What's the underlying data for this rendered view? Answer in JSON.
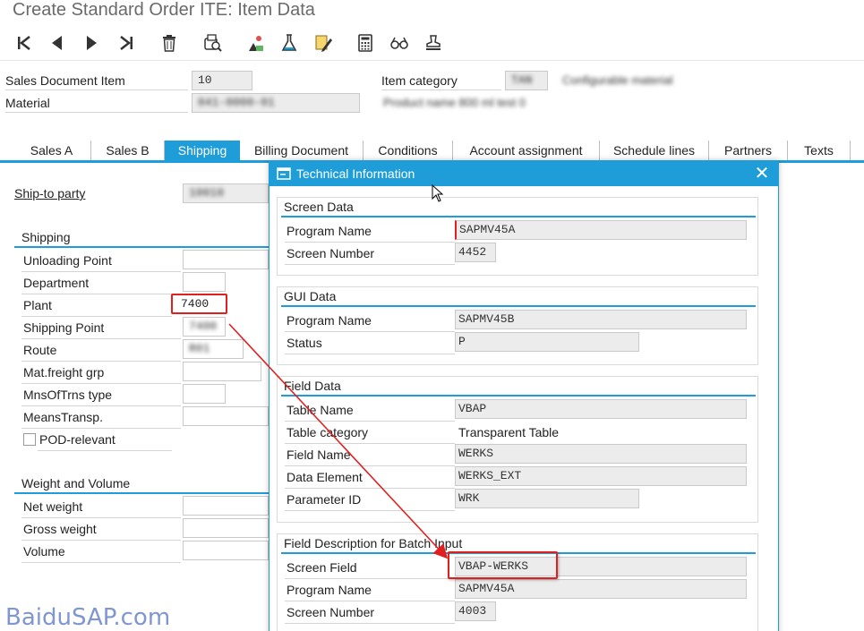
{
  "window": {
    "title": "Create Standard Order ITE: Item Data"
  },
  "toolbar": {
    "buttons": [
      {
        "icon": "first-item-icon"
      },
      {
        "icon": "previous-item-icon"
      },
      {
        "icon": "next-item-icon"
      },
      {
        "icon": "last-item-icon"
      },
      {
        "icon": "delete-icon"
      },
      {
        "icon": "print-preview-icon"
      },
      {
        "icon": "configuration-icon"
      },
      {
        "icon": "flask-icon"
      },
      {
        "icon": "edit-text-icon"
      },
      {
        "icon": "calculator-icon"
      },
      {
        "icon": "display-glasses-icon"
      },
      {
        "icon": "stamp-icon"
      }
    ]
  },
  "header": {
    "sales_doc_item_label": "Sales Document Item",
    "sales_doc_item_value": "10",
    "material_label": "Material",
    "material_value": "041-0000-01",
    "item_category_label": "Item category",
    "item_category_value": "TAN",
    "item_category_desc": "Configurable material",
    "material_desc": "Product name 800 ml test 0"
  },
  "tabs": [
    {
      "label": "Sales A"
    },
    {
      "label": "Sales B"
    },
    {
      "label": "Shipping",
      "active": true
    },
    {
      "label": "Billing Document"
    },
    {
      "label": "Conditions"
    },
    {
      "label": "Account assignment"
    },
    {
      "label": "Schedule lines"
    },
    {
      "label": "Partners"
    },
    {
      "label": "Texts"
    }
  ],
  "shipping_tab": {
    "ship_to_label": "Ship-to party",
    "ship_to_value": "10010",
    "shipping_section": "Shipping",
    "fields": [
      {
        "label": "Unloading Point",
        "value": ""
      },
      {
        "label": "Department",
        "value": ""
      },
      {
        "label": "Plant",
        "value": "7400"
      },
      {
        "label": "Shipping Point",
        "value": "7400"
      },
      {
        "label": "Route",
        "value": "R01"
      },
      {
        "label": "Mat.freight grp",
        "value": ""
      },
      {
        "label": "MnsOfTrns type",
        "value": ""
      },
      {
        "label": "MeansTransp.",
        "value": ""
      }
    ],
    "pod_label": "POD-relevant",
    "weight_section": "Weight and Volume",
    "weight_fields": [
      {
        "label": "Net weight"
      },
      {
        "label": "Gross weight"
      },
      {
        "label": "Volume"
      }
    ]
  },
  "dialog": {
    "title": "Technical Information",
    "screen_data": {
      "heading": "Screen Data",
      "program_name_label": "Program Name",
      "program_name_value": "SAPMV45A",
      "screen_number_label": "Screen Number",
      "screen_number_value": "4452"
    },
    "gui_data": {
      "heading": "GUI Data",
      "program_name_label": "Program Name",
      "program_name_value": "SAPMV45B",
      "status_label": "Status",
      "status_value": "P"
    },
    "field_data": {
      "heading": "Field Data",
      "table_name_label": "Table Name",
      "table_name_value": "VBAP",
      "table_category_label": "Table category",
      "table_category_value": "Transparent Table",
      "field_name_label": "Field Name",
      "field_name_value": "WERKS",
      "data_element_label": "Data Element",
      "data_element_value": "WERKS_EXT",
      "parameter_id_label": "Parameter ID",
      "parameter_id_value": "WRK"
    },
    "batch_input": {
      "heading": "Field Description for Batch Input",
      "screen_field_label": "Screen Field",
      "screen_field_value": "VBAP-WERKS",
      "program_name_label": "Program Name",
      "program_name_value": "SAPMV45A",
      "screen_number_label": "Screen Number",
      "screen_number_value": "4003"
    }
  },
  "watermark": "BaiduSAP.com",
  "colors": {
    "accent": "#1f9dd9",
    "highlight": "#e02020"
  }
}
